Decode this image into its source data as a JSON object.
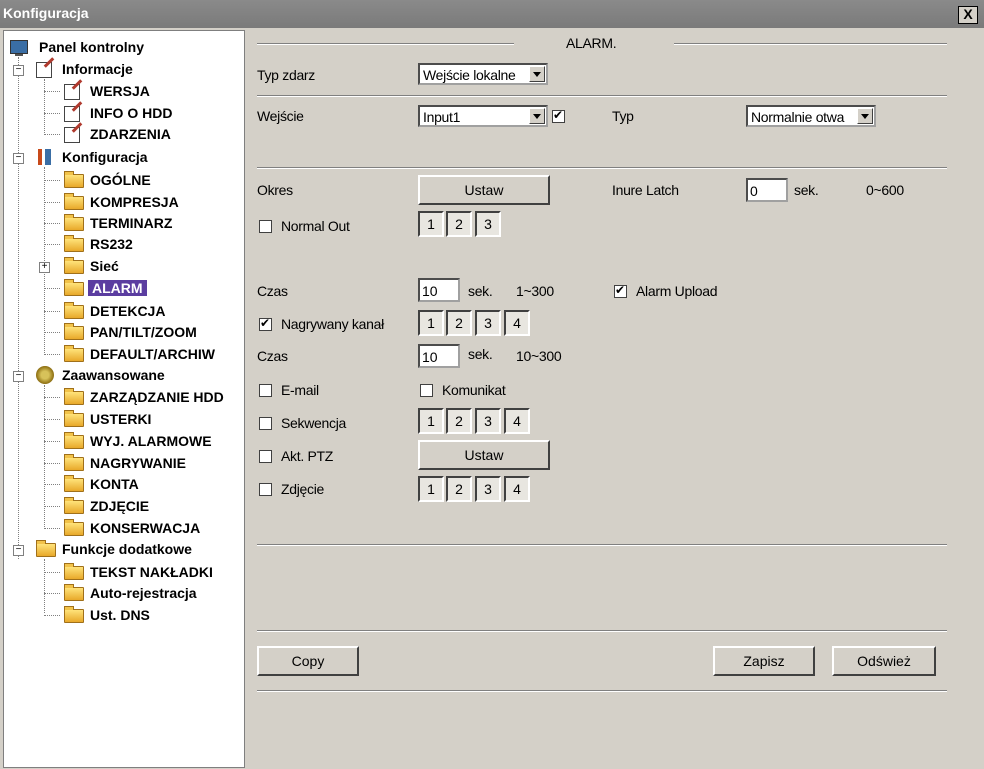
{
  "window": {
    "title": "Konfiguracja",
    "close_label": "X"
  },
  "tree": {
    "root": "Panel kontrolny",
    "informacje": {
      "label": "Informacje",
      "items": [
        "WERSJA",
        "INFO O HDD",
        "ZDARZENIA"
      ]
    },
    "konfiguracja": {
      "label": "Konfiguracja",
      "items": [
        "OGÓLNE",
        "KOMPRESJA",
        "TERMINARZ",
        "RS232",
        "Sieć",
        "ALARM",
        "DETEKCJA",
        "PAN/TILT/ZOOM",
        "DEFAULT/ARCHIW"
      ]
    },
    "zaawansowane": {
      "label": "Zaawansowane",
      "items": [
        "ZARZĄDZANIE HDD",
        "USTERKI",
        "WYJ. ALARMOWE",
        "NAGRYWANIE",
        "KONTA",
        "ZDJĘCIE",
        "KONSERWACJA"
      ]
    },
    "funkcje": {
      "label": "Funkcje dodatkowe",
      "items": [
        "TEKST NAKŁADKI",
        "Auto-rejestracja",
        "Ust. DNS"
      ]
    },
    "selected": "ALARM",
    "expander_minus": "−",
    "expander_plus": "+"
  },
  "alarm": {
    "section_title": "ALARM.",
    "typ_zdarz_label": "Typ zdarz",
    "typ_zdarz_value": "Wejście lokalne",
    "wejscie_label": "Wejście",
    "wejscie_value": "Input1",
    "wejscie_checked": true,
    "typ_label": "Typ",
    "typ_value": "Normalnie otwa",
    "okres_label": "Okres",
    "ustaw_label": "Ustaw",
    "inure_latch_label": "Inure Latch",
    "inure_latch_value": "0",
    "sek": "sek.",
    "inure_range": "0~600",
    "normal_out_label": "Normal Out",
    "normal_out_checked": false,
    "normal_out_channels": [
      "1",
      "2",
      "3"
    ],
    "czas1_label": "Czas",
    "czas1_value": "10",
    "czas1_range": "1~300",
    "alarm_upload_label": "Alarm Upload",
    "alarm_upload_checked": true,
    "nagrywany_label": "Nagrywany kanał",
    "nagrywany_checked": true,
    "channels4": [
      "1",
      "2",
      "3",
      "4"
    ],
    "czas2_label": "Czas",
    "czas2_value": "10",
    "czas2_range": "10~300",
    "email_label": "E-mail",
    "email_checked": false,
    "komunikat_label": "Komunikat",
    "komunikat_checked": false,
    "sekwencja_label": "Sekwencja",
    "sekwencja_checked": false,
    "akt_ptz_label": "Akt. PTZ",
    "akt_ptz_checked": false,
    "zdjecie_label": "Zdjęcie",
    "zdjecie_checked": false,
    "copy_label": "Copy",
    "zapisz_label": "Zapisz",
    "odswiez_label": "Odśwież"
  }
}
